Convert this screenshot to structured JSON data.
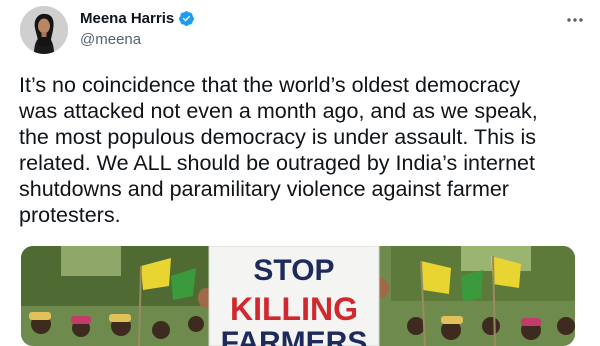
{
  "tweet": {
    "author": {
      "display_name": "Meena Harris",
      "handle": "@meena",
      "verified": true,
      "verified_icon": "verified-badge-icon"
    },
    "more_icon": "more-options-icon",
    "text": "It’s no coincidence that the world’s oldest democracy\nwas attacked not even a month ago, and as we speak,\nthe most populous democracy is under assault. This is\nrelated. We ALL should be outraged by India’s internet\nshutdowns and paramilitary violence against farmer\nprotesters.",
    "media": {
      "sign_lines": [
        "STOP",
        "KILLING",
        "FARMERS"
      ]
    }
  },
  "colors": {
    "text": "#0f1419",
    "secondary": "#536471",
    "verified_blue": "#1d9bf0",
    "sign_navy": "#1f2a5c",
    "sign_red": "#d0282e"
  }
}
